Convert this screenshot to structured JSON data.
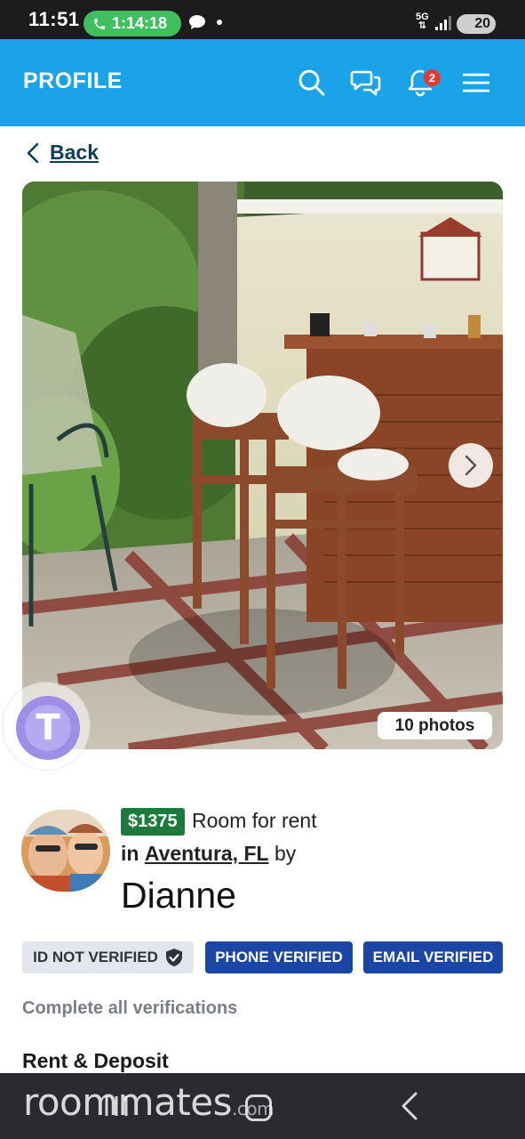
{
  "status_bar": {
    "time": "11:51",
    "call_timer": "1:14:18",
    "network": "5G",
    "battery": "20"
  },
  "header": {
    "title": "PROFILE",
    "notification_count": "2",
    "accent_color": "#1aa3e8"
  },
  "back_label": "Back",
  "photo": {
    "count_label": "10 photos"
  },
  "floating_bubble": {
    "letter": "T"
  },
  "listing": {
    "price": "$1375",
    "type": "Room for rent",
    "location_prefix": "in",
    "location": "Aventura, FL",
    "location_suffix": "by",
    "owner_name": "Dianne"
  },
  "verifications": {
    "id": "ID NOT VERIFIED",
    "phone": "PHONE VERIFIED",
    "email": "EMAIL VERIFIED",
    "complete_prompt": "Complete all verifications"
  },
  "section_title": "Rent & Deposit",
  "watermark": {
    "brand": "roommates",
    "suffix": ".com"
  }
}
